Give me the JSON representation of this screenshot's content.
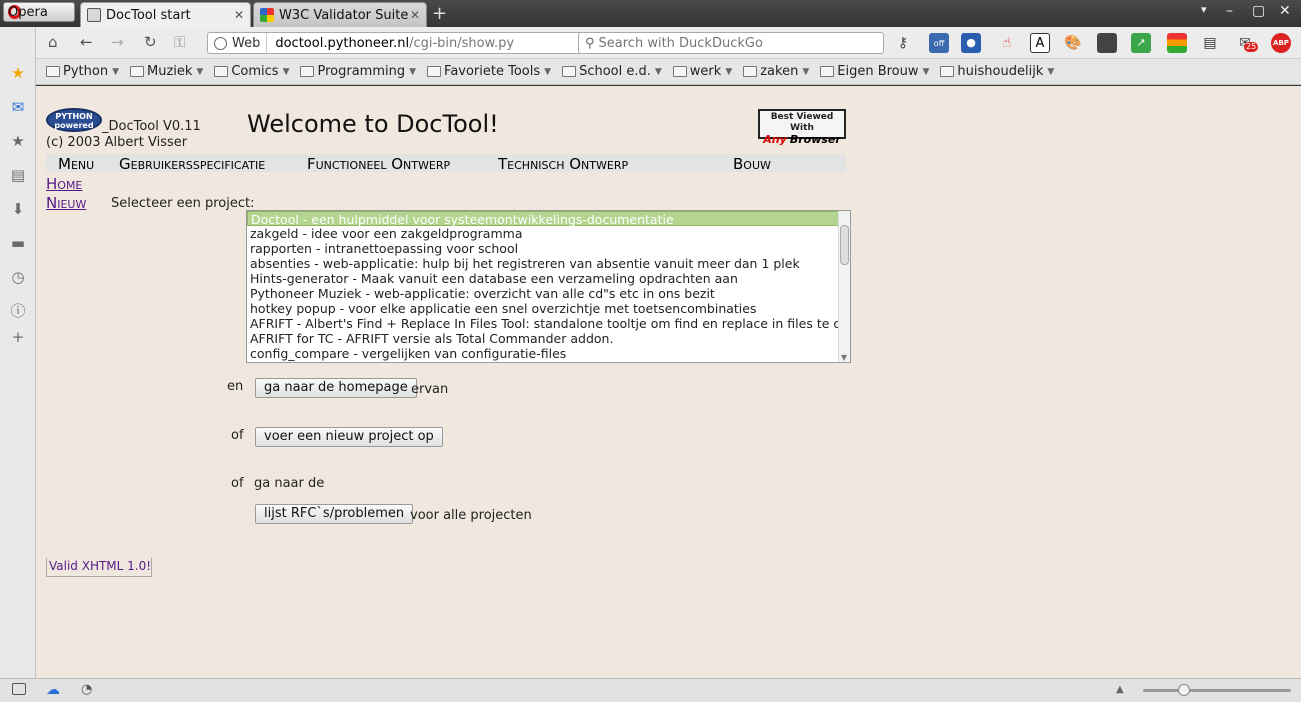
{
  "browser": {
    "menu_button": "Opera",
    "tabs": [
      {
        "title": "DocTool start",
        "active": true
      },
      {
        "title": "W3C Validator Suite",
        "active": false
      }
    ],
    "address": {
      "scheme_label": "Web",
      "host": "doctool.pythoneer.nl",
      "path": "/cgi-bin/show.py"
    },
    "search_placeholder": "Search with DuckDuckGo",
    "extensions": [
      {
        "icon": "key-icon"
      },
      {
        "icon": "webcam-off-icon",
        "badge": "off"
      },
      {
        "icon": "1password-icon"
      },
      {
        "icon": "hand-pointer-icon"
      },
      {
        "icon": "text-A-icon"
      },
      {
        "icon": "palette-icon"
      },
      {
        "icon": "toolbox-icon"
      },
      {
        "icon": "green-arrow-icon"
      },
      {
        "icon": "color-bars-icon"
      },
      {
        "icon": "page-tool-icon"
      },
      {
        "icon": "mail-notifier-icon",
        "badge": "25"
      },
      {
        "icon": "adblock-plus-icon",
        "label": "ABP"
      }
    ],
    "bookmarks": [
      "Python",
      "Muziek",
      "Comics",
      "Programming",
      "Favoriete Tools",
      "School e.d.",
      "werk",
      "zaken",
      "Eigen Brouw",
      "huishoudelijk"
    ],
    "side_panel_icons": [
      "star-icon",
      "mail-icon",
      "bookmark-star-icon",
      "notes-icon",
      "download-icon",
      "window-icon",
      "history-icon",
      "info-icon",
      "add-icon"
    ]
  },
  "page": {
    "logo_text": "PYTHON powered",
    "version": "_DocTool V0.11",
    "copyright": "(c) 2003 Albert Visser",
    "welcome": "Welcome to DocTool!",
    "best_viewed": {
      "line1": "Best Viewed With",
      "any": "Any",
      "browser": "Browser"
    },
    "menu": [
      "Menu",
      "Gebruikersspecificatie",
      "Functioneel Ontwerp",
      "Technisch Ontwerp",
      "Bouw"
    ],
    "nav": {
      "home": "Home",
      "nieuw": "Nieuw"
    },
    "select_label": "Selecteer een project:",
    "projects": [
      "Doctool - een hulpmiddel voor systeemontwikkelings-documentatie",
      "zakgeld - idee voor een zakgeldprogramma",
      "rapporten - intranettoepassing voor school",
      "absenties - web-applicatie: hulp bij het registreren van absentie vanuit meer dan 1 plek",
      "Hints-generator - Maak vanuit een database een verzameling opdrachten aan",
      "Pythoneer Muziek - web-applicatie: overzicht van alle cd\"s etc in ons bezit",
      "hotkey popup - voor elke applicatie een snel overzichtje met toetsencombinaties",
      "AFRIFT - Albert's Find + Replace In Files Tool: standalone tooltje om find en replace in files te doen",
      "AFRIFT for TC - AFRIFT versie als Total Commander addon.",
      "config_compare - vergelijken van configuratie-files"
    ],
    "selected_project_index": 0,
    "actions": {
      "en_label": "en",
      "homepage_button": "ga naar de homepage",
      "ervan_label": "ervan",
      "of1_label": "of",
      "new_project_button": "voer een nieuw project op",
      "of2_label": "of",
      "ga_naar_de": "ga naar de",
      "rfc_button": "lijst RFC`s/problemen",
      "voor_alle": "voor alle projecten"
    },
    "valid_badge": "Valid XHTML 1.0!"
  },
  "colors": {
    "page_bg": "#f0e8de",
    "selected_bg": "#b4d58f",
    "link": "#551a8b"
  }
}
